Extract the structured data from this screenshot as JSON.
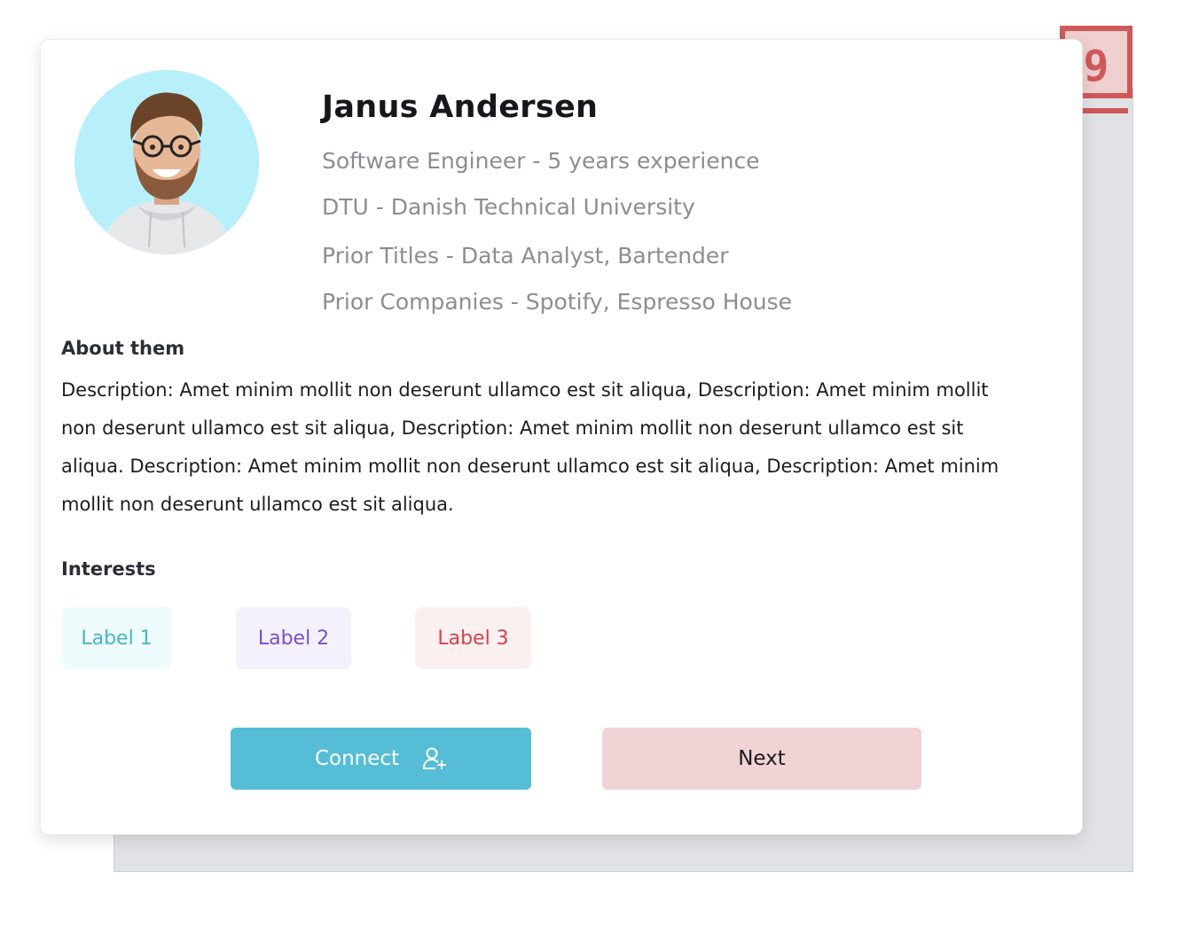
{
  "badge": {
    "number": "9",
    "color": "#d0585a"
  },
  "profile": {
    "name": "Janus Andersen",
    "headline": "Software Engineer - 5 years experience",
    "education": "DTU - Danish Technical University",
    "prior_titles": "Prior Titles - Data Analyst, Bartender",
    "prior_companies": "Prior Companies - Spotify, Espresso House",
    "avatar_icon": "user-photo"
  },
  "about": {
    "title": "About them",
    "text": "Description: Amet minim mollit non deserunt ullamco est sit aliqua, Description: Amet minim mollit non deserunt ullamco est sit aliqua, Description: Amet minim mollit non deserunt ullamco est sit aliqua. Description: Amet minim mollit non deserunt ullamco est sit aliqua, Description: Amet minim mollit non deserunt ullamco est sit aliqua."
  },
  "interests": {
    "title": "Interests",
    "labels": [
      "Label 1",
      "Label 2",
      "Label 3"
    ]
  },
  "actions": {
    "connect_label": "Connect",
    "connect_icon": "add-user-icon",
    "next_label": "Next"
  },
  "colors": {
    "accent": "#55bdd6",
    "next_button": "#f1d3d5",
    "avatar_bg": "#b7f0fa"
  }
}
